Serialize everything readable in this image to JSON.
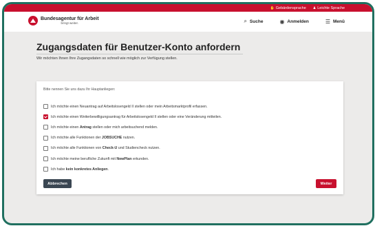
{
  "topbar": {
    "sign_language": "Gebärdensprache",
    "easy_language": "Leichte Sprache"
  },
  "header": {
    "logo_title": "Bundesagentur für Arbeit",
    "logo_subtitle": "bringt weiter.",
    "search_label": "Suche",
    "login_label": "Anmelden",
    "menu_label": "Menü"
  },
  "page": {
    "title": "Zugangsdaten für Benutzer-Konto anfordern",
    "intro": "Wir möchten Ihnen Ihre Zugangsdaten so schnell wie möglich zur Verfügung stellen."
  },
  "form": {
    "prompt": "Bitte nennen Sie uns dazu Ihr Hauptanliegen:",
    "options": [
      {
        "pre": "Ich möchte einen Neuantrag auf Arbeitslosengeld II stellen oder mein Arbeitsmarktprofil erfassen.",
        "bold": "",
        "post": "",
        "checked": false
      },
      {
        "pre": "Ich möchte einen Weiterbewilligungsantrag für Arbeitslosengeld II stellen oder eine Veränderung mitteilen.",
        "bold": "",
        "post": "",
        "checked": true
      },
      {
        "pre": "Ich möchte einen ",
        "bold": "Antrag",
        "post": " stellen oder mich arbeitsuchend melden.",
        "checked": false
      },
      {
        "pre": "Ich möchte alle Funktionen der ",
        "bold": "JOBSUCHE",
        "post": " nutzen.",
        "checked": false
      },
      {
        "pre": "Ich möchte alle Funktionen von ",
        "bold": "Check-U",
        "post": " und Studiencheck nutzen.",
        "checked": false
      },
      {
        "pre": "Ich möchte meine berufliche Zukunft mit ",
        "bold": "NewPlan",
        "post": " erkunden.",
        "checked": false
      },
      {
        "pre": "Ich habe ",
        "bold": "kein konkretes Anliegen",
        "post": ".",
        "checked": false
      }
    ],
    "cancel_label": "Abbrechen",
    "next_label": "Weiter"
  }
}
